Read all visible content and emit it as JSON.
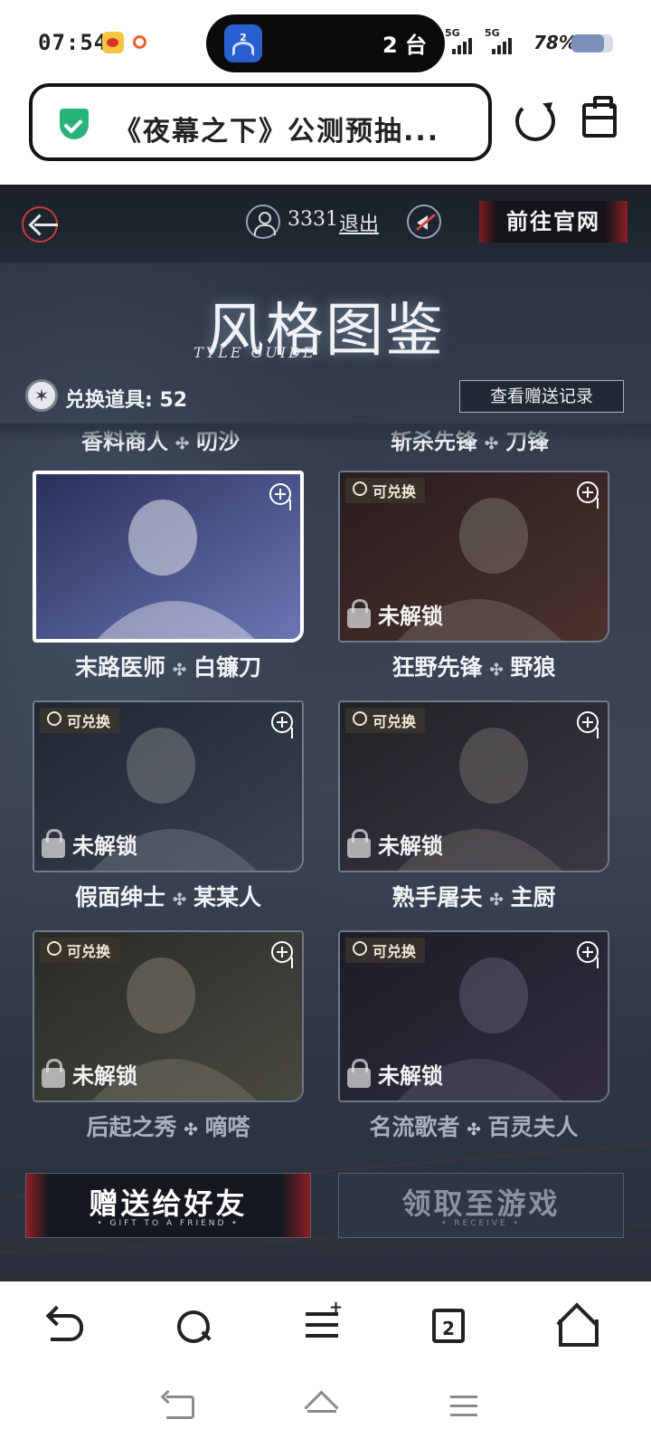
{
  "status_bar": {
    "time": "07:54",
    "island_badge": "2",
    "island_text": "2 台",
    "signal_1": "5G",
    "signal_2": "5G",
    "battery_percent": "78%",
    "battery_level": 0.78
  },
  "browser": {
    "url_title": "《夜幕之下》公测预抽...",
    "tab_count": "2"
  },
  "game": {
    "user_id": "3331",
    "logout_label": "退出",
    "official_site_label": "前往官网",
    "title": "风格图鉴",
    "subtitle": "TYLE GUIDE",
    "token_label": "兑换道具: 52",
    "gift_record_label": "查看赠送记录",
    "cut_row": {
      "left": {
        "role": "香料商人",
        "name": "叨沙"
      },
      "right": {
        "role": "斩杀先锋",
        "name": "刀锋"
      }
    },
    "redeemable_badge": "可兑换",
    "locked_label": "未解锁",
    "cards": [
      {
        "role": "末路医师",
        "name": "白镰刀",
        "locked": false,
        "selected": true,
        "dim_label": false
      },
      {
        "role": "狂野先锋",
        "name": "野狼",
        "locked": true,
        "selected": false,
        "dim_label": false
      },
      {
        "role": "假面绅士",
        "name": "某某人",
        "locked": true,
        "selected": false,
        "dim_label": false
      },
      {
        "role": "熟手屠夫",
        "name": "主厨",
        "locked": true,
        "selected": false,
        "dim_label": false
      },
      {
        "role": "后起之秀",
        "name": "嘀嗒",
        "locked": true,
        "selected": false,
        "dim_label": true
      },
      {
        "role": "名流歌者",
        "name": "百灵夫人",
        "locked": true,
        "selected": false,
        "dim_label": true
      }
    ],
    "gift_button": {
      "label": "赠送给好友",
      "sub": "• GIFT TO A FRIEND •"
    },
    "receive_button": {
      "label": "领取至游戏",
      "sub": "• RECEIVE •"
    }
  }
}
